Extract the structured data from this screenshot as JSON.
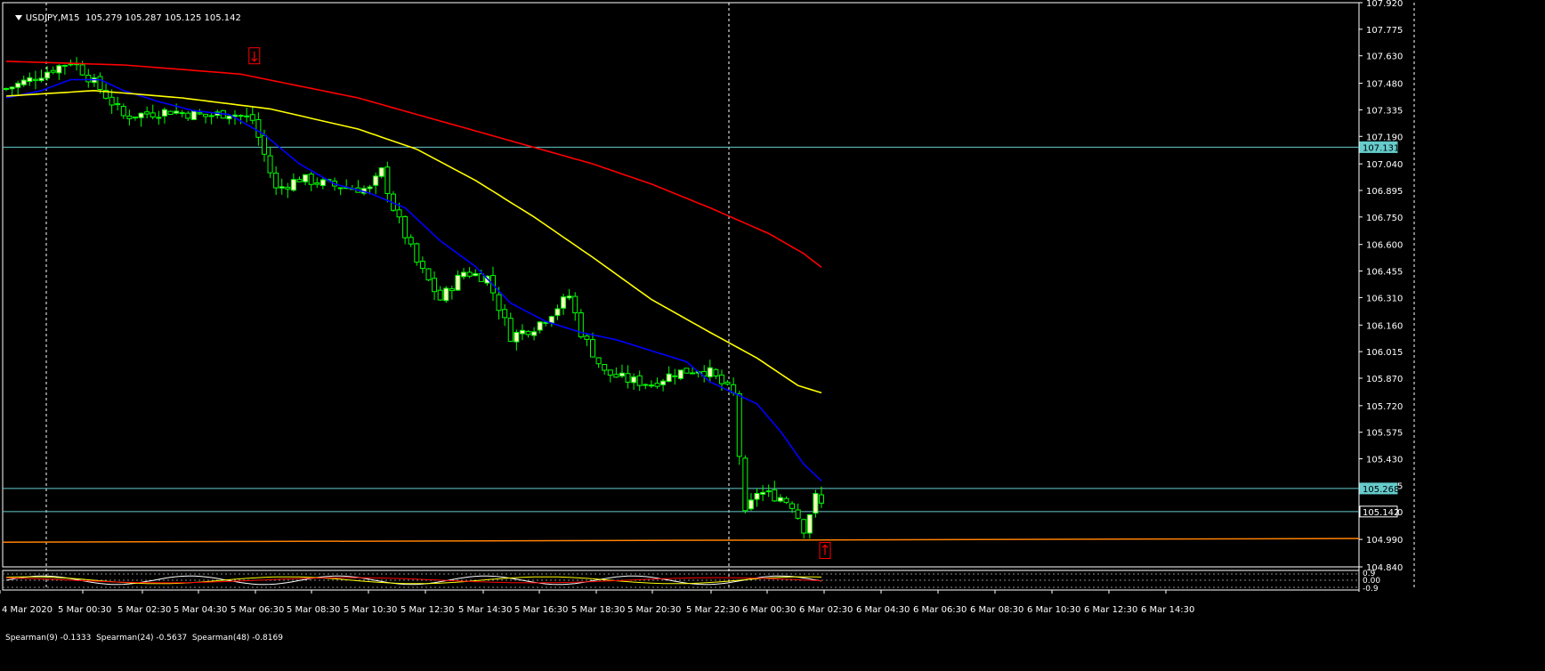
{
  "header": {
    "symbol": "USDJPY,M15",
    "open": "105.279",
    "high": "105.287",
    "low": "105.125",
    "close": "105.142"
  },
  "indicator_header": {
    "text": "Spearman(9) -0.1333  Spearman(24) -0.5637  Spearman(48) -0.8169",
    "levels": [
      "0.9",
      "0.00",
      "-0.9"
    ]
  },
  "colors": {
    "background": "#000000",
    "bull_candle": "#ffffc0",
    "bear_candle": "#000000",
    "wick": "#00ff00",
    "ma_fast": "#0000ff",
    "ma_mid": "#ffff00",
    "ma_slow": "#ff0000",
    "hline": "#66cccc",
    "support_line": "#ff8000",
    "price_tag_bg": "#66cccc",
    "axis_text": "#ffffff",
    "grid": "#ffffff",
    "arrow": "#ff0000"
  },
  "chart_data": {
    "type": "candlestick",
    "title": "USDJPY,M15",
    "ylim": [
      104.84,
      107.92
    ],
    "y_ticks": [
      "107.920",
      "107.775",
      "107.630",
      "107.480",
      "107.335",
      "107.190",
      "107.040",
      "106.895",
      "106.750",
      "106.600",
      "106.455",
      "106.310",
      "106.160",
      "106.015",
      "105.870",
      "105.720",
      "105.575",
      "105.430",
      "105.285",
      "105.140",
      "104.990",
      "104.840"
    ],
    "x_tick_labels": [
      "4 Mar 2020",
      "5 Mar 00:30",
      "5 Mar 02:30",
      "5 Mar 04:30",
      "5 Mar 06:30",
      "5 Mar 08:30",
      "5 Mar 10:30",
      "5 Mar 12:30",
      "5 Mar 14:30",
      "5 Mar 16:30",
      "5 Mar 18:30",
      "5 Mar 20:30",
      "5 Mar 22:30",
      "6 Mar 00:30",
      "6 Mar 02:30",
      "6 Mar 04:30",
      "6 Mar 06:30",
      "6 Mar 08:30",
      "6 Mar 10:30",
      "6 Mar 12:30",
      "6 Mar 14:30"
    ],
    "candle_count": 140,
    "price_tags": [
      {
        "label": "107.131",
        "value": 107.131,
        "style": "filled"
      },
      {
        "label": "105.268",
        "value": 105.268,
        "style": "filled"
      },
      {
        "label": "105.142",
        "value": 105.142,
        "style": "outline"
      }
    ],
    "horizontal_lines": [
      107.131,
      105.268,
      105.142
    ],
    "support_line": {
      "from": 104.975,
      "to": 104.995
    },
    "series": [
      {
        "name": "MA fast",
        "color": "#0000ff",
        "anchors": [
          [
            0,
            107.4
          ],
          [
            6,
            107.44
          ],
          [
            11,
            107.5
          ],
          [
            16,
            107.5
          ],
          [
            20,
            107.44
          ],
          [
            26,
            107.38
          ],
          [
            32,
            107.33
          ],
          [
            38,
            107.31
          ],
          [
            44,
            107.2
          ],
          [
            50,
            107.04
          ],
          [
            56,
            106.93
          ],
          [
            62,
            106.88
          ],
          [
            68,
            106.8
          ],
          [
            74,
            106.62
          ],
          [
            80,
            106.48
          ],
          [
            86,
            106.28
          ],
          [
            92,
            106.18
          ],
          [
            98,
            106.12
          ],
          [
            104,
            106.08
          ],
          [
            110,
            106.02
          ],
          [
            116,
            105.96
          ],
          [
            120,
            105.85
          ],
          [
            124,
            105.79
          ],
          [
            128,
            105.73
          ],
          [
            132,
            105.58
          ],
          [
            136,
            105.4
          ],
          [
            140,
            105.28
          ]
        ]
      },
      {
        "name": "MA mid",
        "color": "#ffff00",
        "anchors": [
          [
            0,
            107.41
          ],
          [
            15,
            107.44
          ],
          [
            30,
            107.4
          ],
          [
            45,
            107.34
          ],
          [
            60,
            107.23
          ],
          [
            70,
            107.12
          ],
          [
            80,
            106.95
          ],
          [
            90,
            106.75
          ],
          [
            100,
            106.53
          ],
          [
            110,
            106.3
          ],
          [
            120,
            106.12
          ],
          [
            128,
            105.98
          ],
          [
            135,
            105.83
          ],
          [
            140,
            105.78
          ]
        ]
      },
      {
        "name": "MA slow",
        "color": "#ff0000",
        "anchors": [
          [
            0,
            107.6
          ],
          [
            20,
            107.58
          ],
          [
            40,
            107.53
          ],
          [
            60,
            107.4
          ],
          [
            80,
            107.22
          ],
          [
            90,
            107.13
          ],
          [
            100,
            107.04
          ],
          [
            110,
            106.93
          ],
          [
            120,
            106.8
          ],
          [
            130,
            106.66
          ],
          [
            136,
            106.55
          ],
          [
            140,
            106.45
          ]
        ]
      }
    ],
    "candle_closes_anchors": [
      [
        0,
        107.45
      ],
      [
        4,
        107.5
      ],
      [
        8,
        107.56
      ],
      [
        11,
        107.6
      ],
      [
        12,
        107.58
      ],
      [
        16,
        107.45
      ],
      [
        20,
        107.3
      ],
      [
        28,
        107.33
      ],
      [
        34,
        107.3
      ],
      [
        38,
        107.32
      ],
      [
        42,
        107.28
      ],
      [
        46,
        106.9
      ],
      [
        50,
        106.96
      ],
      [
        56,
        106.92
      ],
      [
        62,
        106.9
      ],
      [
        64,
        107.0
      ],
      [
        66,
        106.8
      ],
      [
        70,
        106.5
      ],
      [
        74,
        106.3
      ],
      [
        78,
        106.45
      ],
      [
        82,
        106.42
      ],
      [
        86,
        106.1
      ],
      [
        90,
        106.15
      ],
      [
        92,
        106.2
      ],
      [
        96,
        106.32
      ],
      [
        98,
        106.12
      ],
      [
        102,
        105.9
      ],
      [
        106,
        105.86
      ],
      [
        110,
        105.84
      ],
      [
        114,
        105.9
      ],
      [
        118,
        105.92
      ],
      [
        120,
        105.9
      ],
      [
        124,
        105.78
      ],
      [
        126,
        105.12
      ],
      [
        128,
        105.25
      ],
      [
        132,
        105.22
      ],
      [
        134,
        105.18
      ],
      [
        136,
        105.05
      ],
      [
        138,
        105.22
      ],
      [
        140,
        105.14
      ]
    ],
    "sell_arrows": [
      {
        "x_index": 42,
        "price": 107.63
      }
    ],
    "buy_arrows": [
      {
        "x_index": 139,
        "price": 104.93
      }
    ],
    "vertical_dashes_idx": [
      5,
      85,
      169
    ]
  }
}
